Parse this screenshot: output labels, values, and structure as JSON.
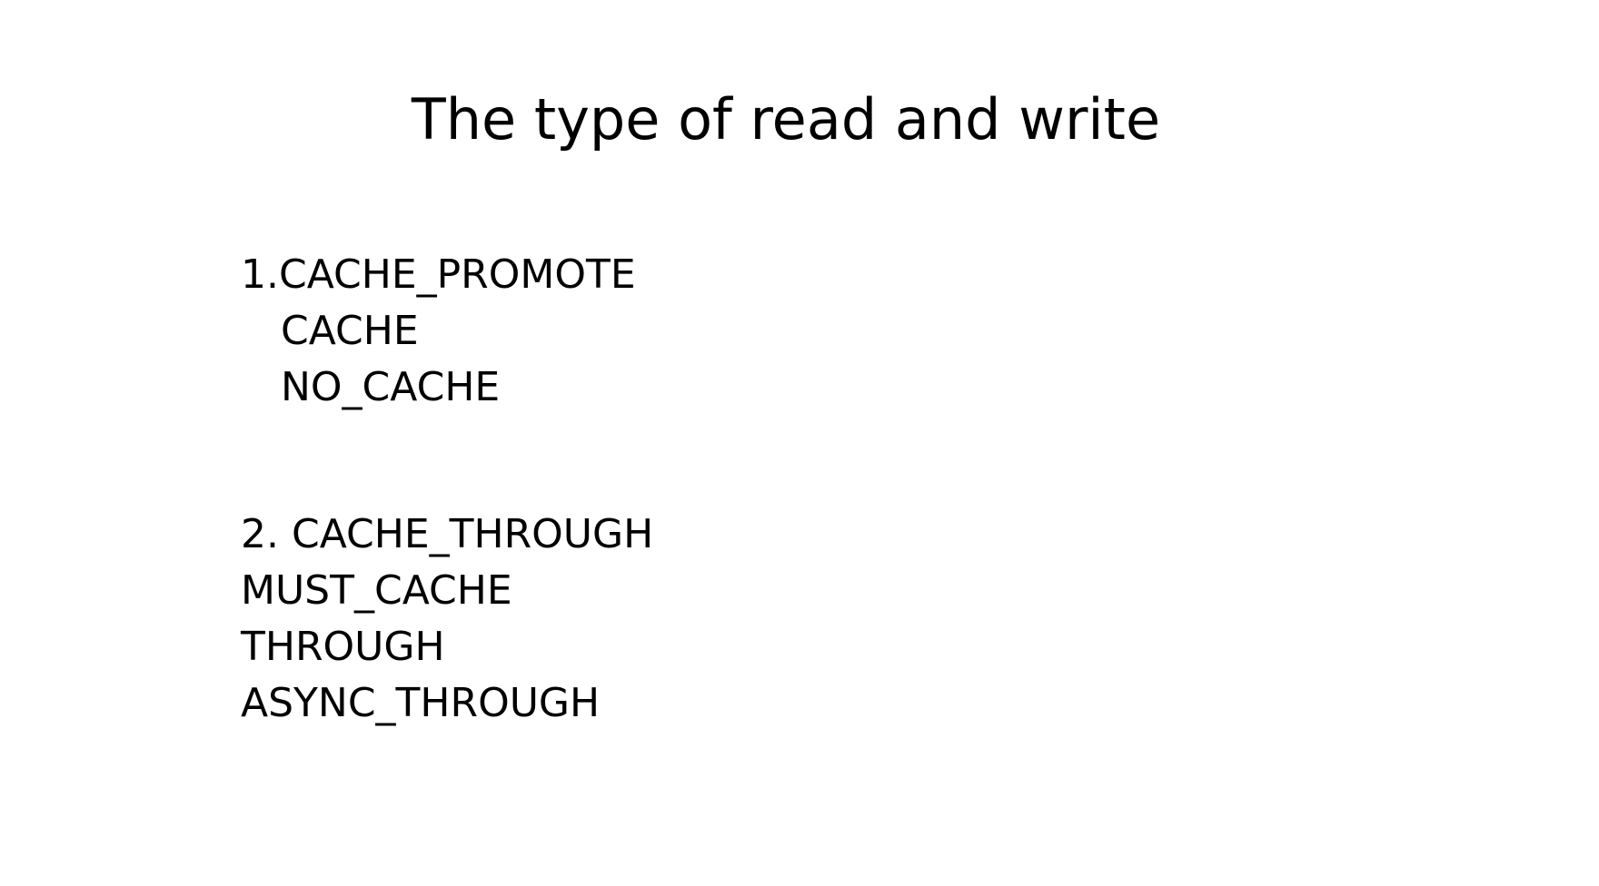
{
  "slide": {
    "title": "The type of read and write",
    "section_1": {
      "heading": "1.CACHE_PROMOTE",
      "items": [
        "CACHE",
        "NO_CACHE"
      ]
    },
    "section_2": {
      "heading": "2. CACHE_THROUGH",
      "items": [
        "MUST_CACHE",
        "THROUGH",
        "ASYNC_THROUGH"
      ]
    }
  },
  "colors": {
    "background": "#ffffff",
    "text": "#000000"
  }
}
